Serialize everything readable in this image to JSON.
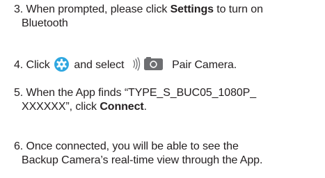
{
  "steps": {
    "s3": {
      "number": "3.",
      "pre": "When prompted, please click ",
      "bold": "Settings",
      "post": " to turn on",
      "line2": "Bluetooth"
    },
    "s4": {
      "number": "4.",
      "pre": "Click",
      "mid": "and select",
      "post": "Pair Camera.",
      "gear_icon": "settings-gear-icon",
      "pair_icon": "bluetooth-signal-camera-icon"
    },
    "s5": {
      "number": "5.",
      "pre": "When the App finds “TYPE_S_BUC05_1080P_",
      "line2_pre": "XXXXXX”, click ",
      "bold": "Connect",
      "post": "."
    },
    "s6": {
      "number": "6.",
      "line1": "Once connected, you will be able to see the",
      "line2": "Backup Camera’s real-time view through the App."
    }
  },
  "colors": {
    "text": "#231f20",
    "gear_blue": "#2fa7e0",
    "icon_grey": "#6d6e71"
  }
}
